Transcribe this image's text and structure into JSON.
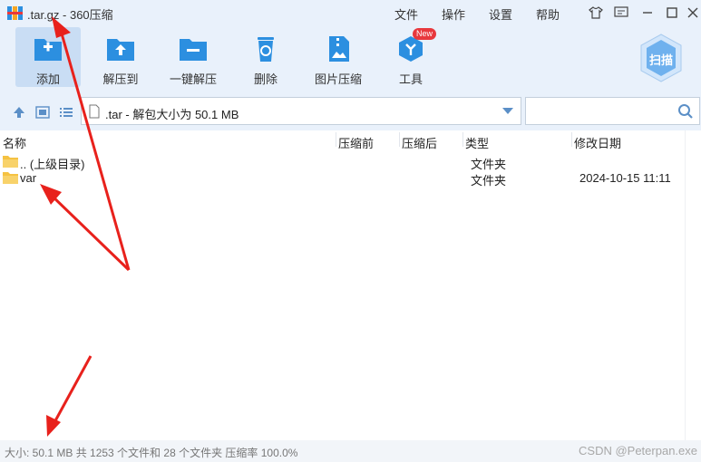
{
  "window": {
    "title": ".tar.gz - 360压缩",
    "menu": [
      "文件",
      "操作",
      "设置",
      "帮助"
    ],
    "window_controls": [
      "skin-icon",
      "feedback-icon",
      "minimize-icon",
      "maximize-icon",
      "close-icon"
    ]
  },
  "toolbar": {
    "items": [
      {
        "label": "添加",
        "icon": "add-icon",
        "active": true
      },
      {
        "label": "解压到",
        "icon": "extract-to-icon"
      },
      {
        "label": "一键解压",
        "icon": "one-click-extract-icon"
      },
      {
        "label": "删除",
        "icon": "delete-icon"
      },
      {
        "label": "图片压缩",
        "icon": "image-compress-icon"
      },
      {
        "label": "工具",
        "icon": "tools-icon",
        "badge": "New"
      }
    ],
    "scan_label": "扫描"
  },
  "address": {
    "path": ".tar - 解包大小为 50.1 MB",
    "search_value": ""
  },
  "columns": [
    "名称",
    "压缩前",
    "压缩后",
    "类型",
    "修改日期"
  ],
  "rows": [
    {
      "name": ".. (上级目录)",
      "type": "文件夹",
      "date": ""
    },
    {
      "name": "var",
      "type": "文件夹",
      "date": "2024-10-15 11:11"
    }
  ],
  "status": {
    "text": "大小: 50.1 MB 共 1253 个文件和 28 个文件夹 压缩率 100.0%",
    "watermark": "CSDN @Peterpan.exe"
  },
  "colors": {
    "toolbar_bg": "#e9f1fb",
    "icon_blue": "#2c8fe0",
    "folder_yellow": "#f5c242",
    "annotation_red": "#e8211c",
    "badge_red": "#e8383d"
  }
}
